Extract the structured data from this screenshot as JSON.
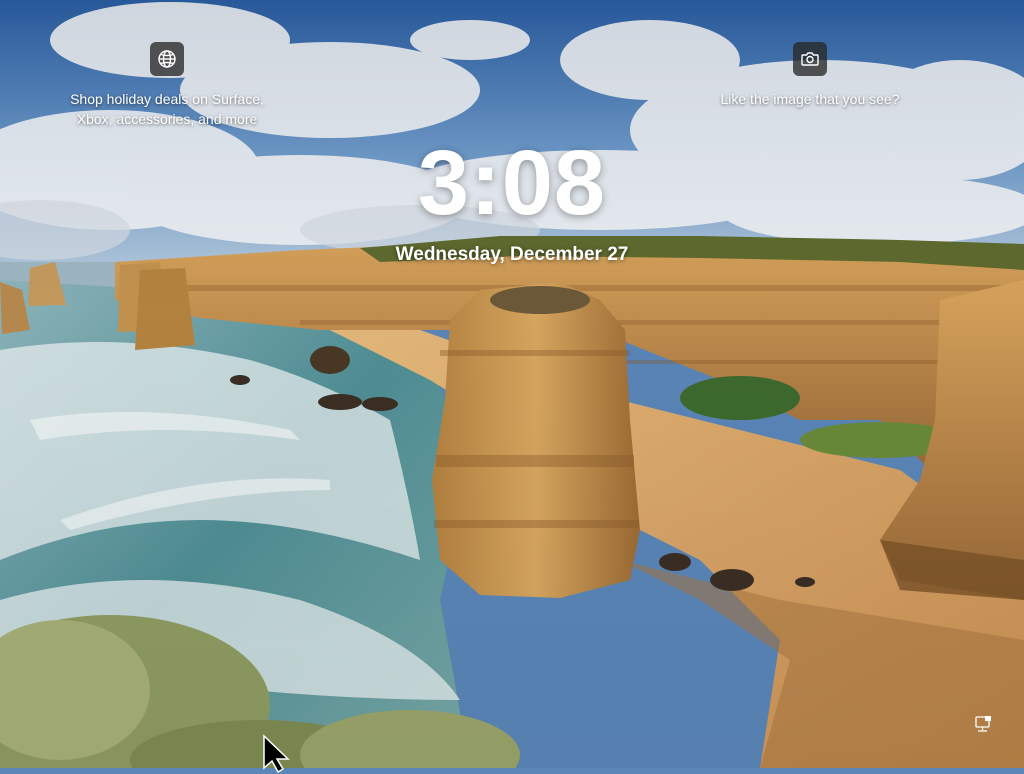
{
  "lock_screen": {
    "time": "3:08",
    "date": "Wednesday, December 27"
  },
  "spotlight_left": {
    "icon": "globe-icon",
    "line1": "Shop holiday deals on Surface,",
    "line2": "Xbox, accessories, and more"
  },
  "spotlight_right": {
    "icon": "camera-icon",
    "text": "Like the image that you see?"
  },
  "status_area": {
    "icon": "network-icon"
  },
  "colors": {
    "sky": "#3f74b8",
    "cliff": "#c9914a",
    "sea": "#5a9aa0",
    "sand": "#d8a86a"
  }
}
